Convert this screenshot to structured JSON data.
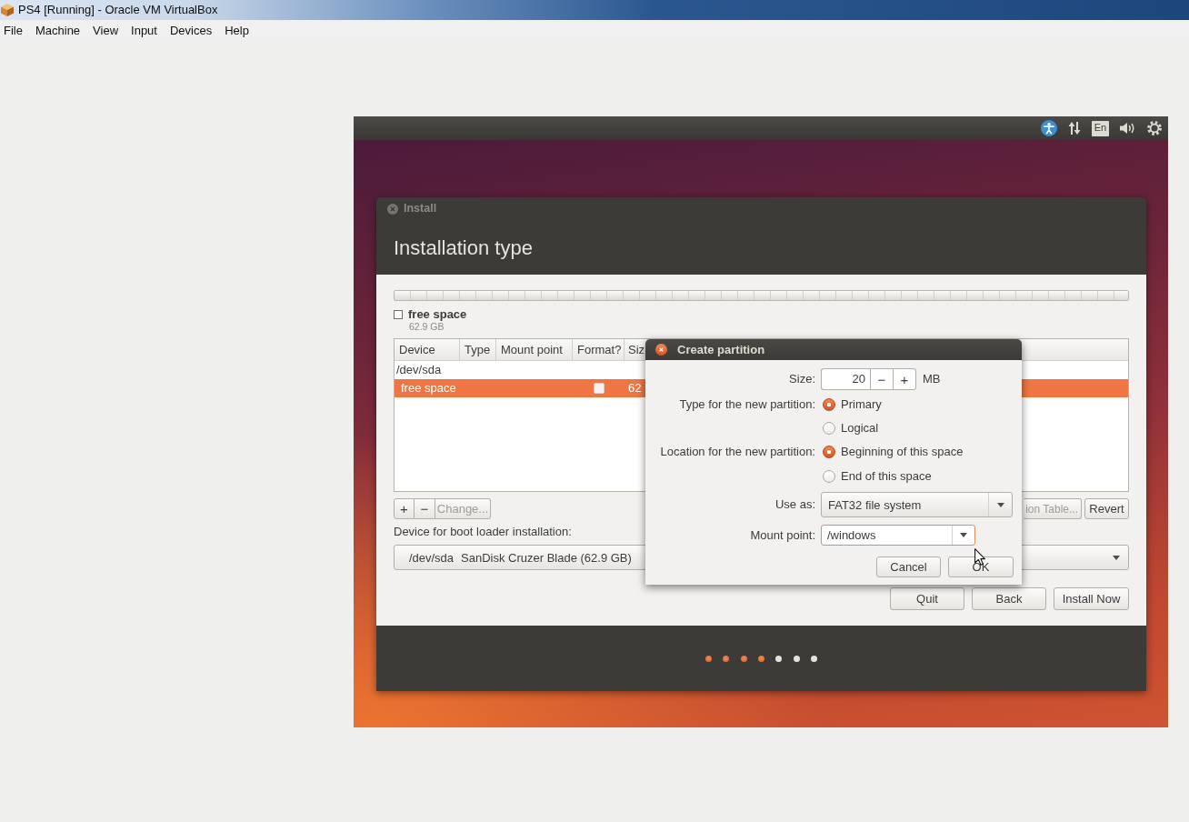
{
  "host_window": {
    "title": "PS4 [Running] - Oracle VM VirtualBox",
    "menu": [
      "File",
      "Machine",
      "View",
      "Input",
      "Devices",
      "Help"
    ]
  },
  "top_panel": {
    "keyboard_layout": "En"
  },
  "install_window": {
    "title": "Install",
    "heading": "Installation type",
    "partition_legend": {
      "label": "free space",
      "size": "62.9 GB"
    },
    "table": {
      "columns": [
        "Device",
        "Type",
        "Mount point",
        "Format?",
        "Siz"
      ],
      "rows": [
        {
          "kind": "disk",
          "device": "/dev/sda",
          "selected": false
        },
        {
          "kind": "partition",
          "device": "free space",
          "format": false,
          "size": "62",
          "selected": true
        }
      ]
    },
    "partition_buttons": [
      {
        "label": "+",
        "disabled": false
      },
      {
        "label": "−",
        "disabled": false
      },
      {
        "label": "Change...",
        "disabled": true
      }
    ],
    "table_buttons": [
      {
        "label": "ion Table...",
        "disabled": true
      },
      {
        "label": "Revert",
        "disabled": false
      }
    ],
    "boot_loader": {
      "label": "Device for boot loader installation:",
      "device": "/dev/sda",
      "description": "SanDisk Cruzer Blade (62.9 GB)"
    },
    "buttons": [
      "Quit",
      "Back",
      "Install Now"
    ],
    "progress_steps": [
      {
        "completed": true
      },
      {
        "completed": true
      },
      {
        "completed": true
      },
      {
        "completed": true
      },
      {
        "completed": false
      },
      {
        "completed": false
      },
      {
        "completed": false
      }
    ]
  },
  "dialog": {
    "title": "Create partition",
    "size": {
      "label": "Size:",
      "value": "20",
      "decrement": "−",
      "increment": "+",
      "unit": "MB"
    },
    "type": {
      "label": "Type for the new partition:",
      "options": [
        {
          "label": "Primary",
          "selected": true
        },
        {
          "label": "Logical",
          "selected": false
        }
      ]
    },
    "location": {
      "label": "Location for the new partition:",
      "options": [
        {
          "label": "Beginning of this space",
          "selected": true
        },
        {
          "label": "End of this space",
          "selected": false
        }
      ]
    },
    "use_as": {
      "label": "Use as:",
      "value": "FAT32 file system"
    },
    "mount_point": {
      "label": "Mount point:",
      "value": "/windows",
      "focused": true
    },
    "buttons": [
      "Cancel",
      "OK"
    ]
  }
}
